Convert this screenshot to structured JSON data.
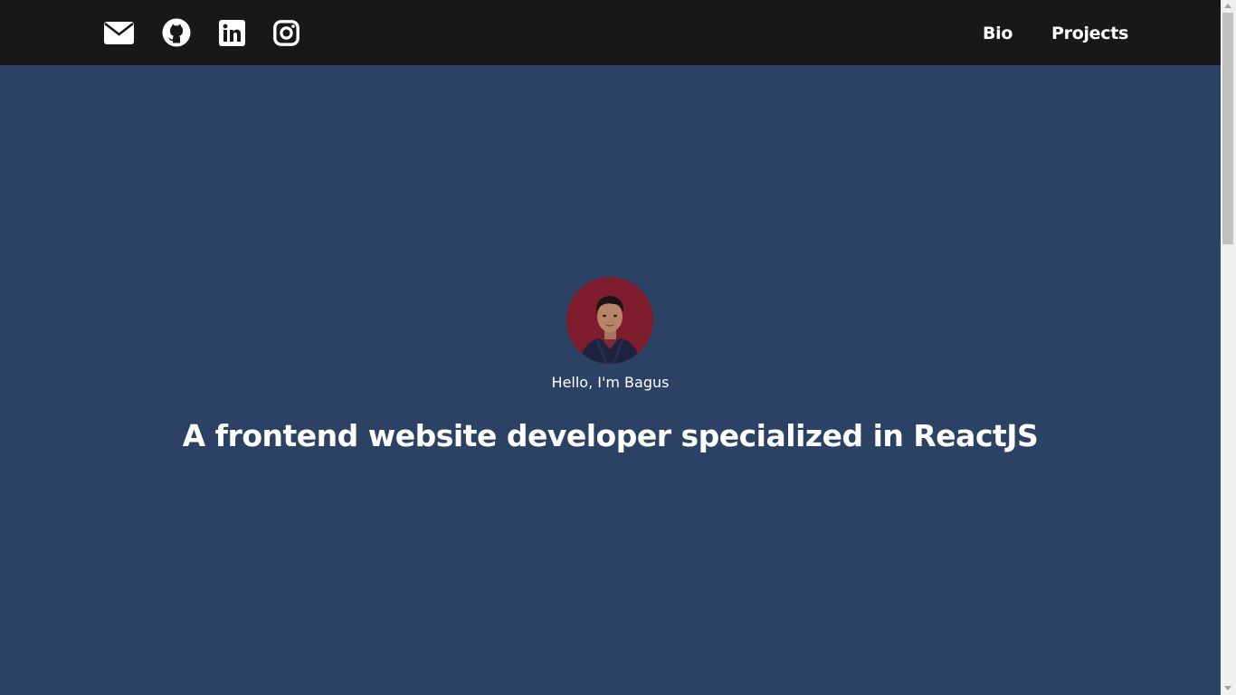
{
  "nav": {
    "icons": [
      "envelope-icon",
      "github-icon",
      "linkedin-icon",
      "instagram-icon"
    ],
    "links": [
      "Bio",
      "Projects"
    ]
  },
  "hero": {
    "greeting": "Hello, I'm Bagus",
    "headline": "A frontend website developer specialized in ReactJS"
  },
  "colors": {
    "navbar": "#18181a",
    "background": "#2c4264",
    "avatar_bg": "#7d1c2d",
    "text": "#ffffff"
  }
}
